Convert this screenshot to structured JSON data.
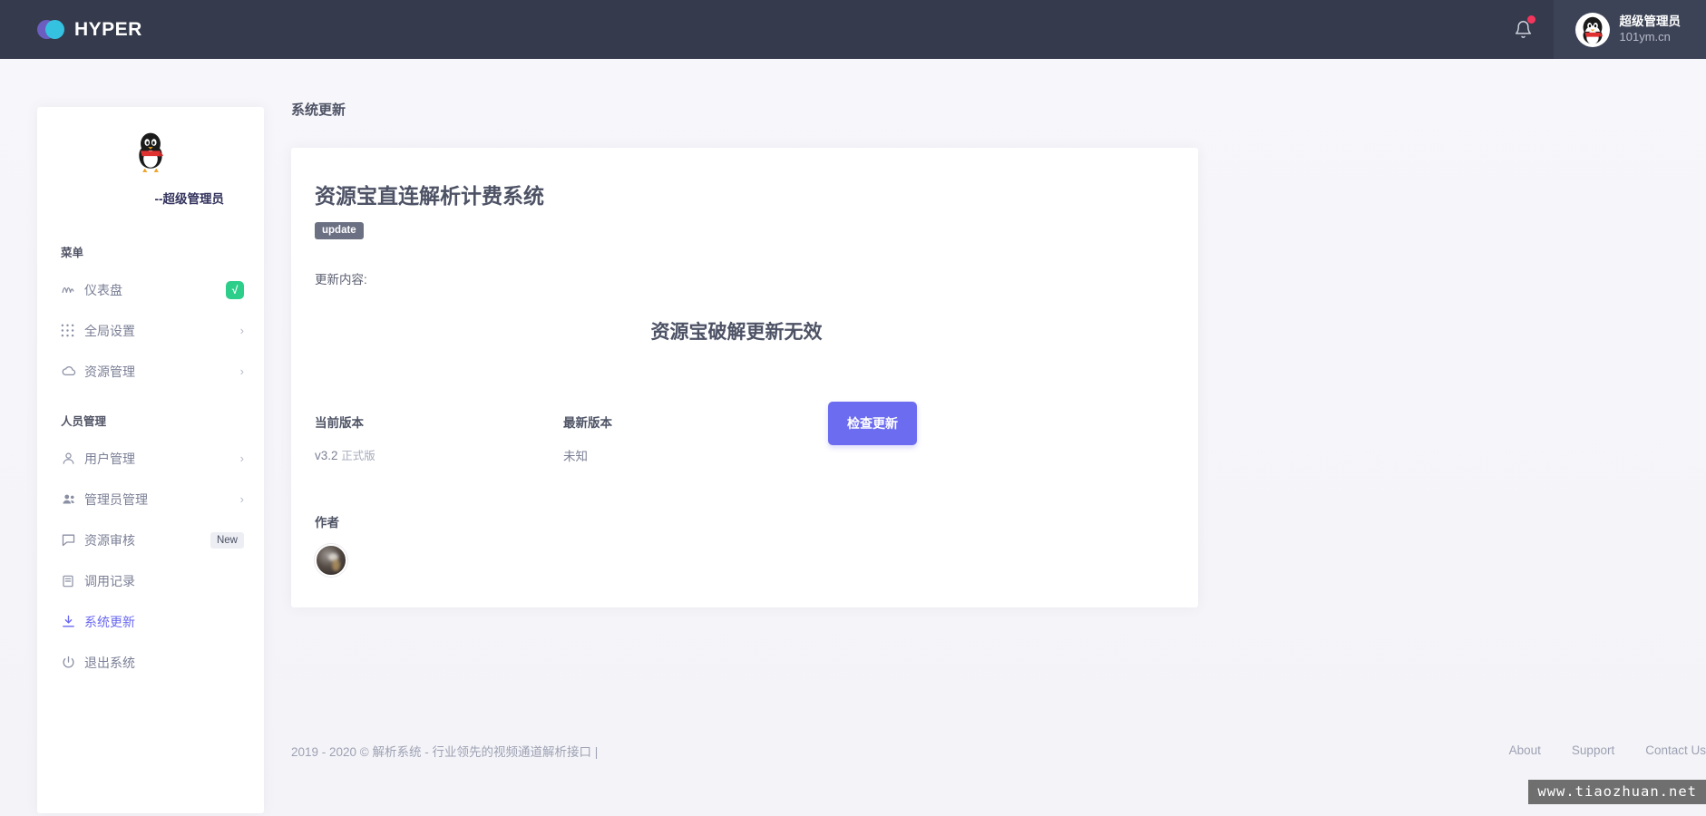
{
  "header": {
    "brand": "HYPER",
    "bell_icon": "bell-icon",
    "notification_dot": true,
    "user": {
      "name": "超级管理员",
      "domain": "101ym.cn",
      "avatar": "qq-penguin-avatar"
    }
  },
  "sidebar": {
    "profile": {
      "avatar": "qq-penguin-avatar",
      "username": "--超级管理员"
    },
    "sections": [
      {
        "title": "菜单",
        "items": [
          {
            "label": "仪表盘",
            "icon": "activity-icon",
            "badge": "√",
            "badge_type": "check",
            "active": false
          },
          {
            "label": "全局设置",
            "icon": "grid-dots-icon",
            "chevron": "›",
            "active": false
          },
          {
            "label": "资源管理",
            "icon": "cloud-icon",
            "chevron": "›",
            "active": false
          }
        ]
      },
      {
        "title": "人员管理",
        "items": [
          {
            "label": "用户管理",
            "icon": "user-icon",
            "chevron": "›",
            "active": false
          },
          {
            "label": "管理员管理",
            "icon": "users-icon",
            "chevron": "›",
            "active": false
          },
          {
            "label": "资源审核",
            "icon": "message-icon",
            "badge": "New",
            "badge_type": "new",
            "active": false
          },
          {
            "label": "调用记录",
            "icon": "server-icon",
            "active": false
          },
          {
            "label": "系统更新",
            "icon": "download-icon",
            "active": true
          },
          {
            "label": "退出系统",
            "icon": "power-icon",
            "active": false
          }
        ]
      }
    ]
  },
  "main": {
    "page_title": "系统更新",
    "card": {
      "title": "资源宝直连解析计费系统",
      "tag": "update",
      "update_label": "更新内容:",
      "update_body": "资源宝破解更新无效",
      "current_version_label": "当前版本",
      "current_version_value": "v3.2",
      "current_version_sub": "正式版",
      "latest_version_label": "最新版本",
      "latest_version_value": "未知",
      "check_button": "检查更新",
      "author_label": "作者",
      "author_avatar": "author-photo-avatar"
    }
  },
  "footer": {
    "copyright": "2019 - 2020 © 解析系统 - 行业领先的视频通道解析接口 |",
    "links": [
      "About",
      "Support",
      "Contact Us"
    ]
  },
  "watermark": "www.tiaozhuan.net",
  "colors": {
    "topbar": "#353a4c",
    "accent_purple": "#6c6cf0",
    "badge_green": "#2dce89",
    "notification_red": "#f5365c",
    "tag_grey": "#6b7082"
  }
}
